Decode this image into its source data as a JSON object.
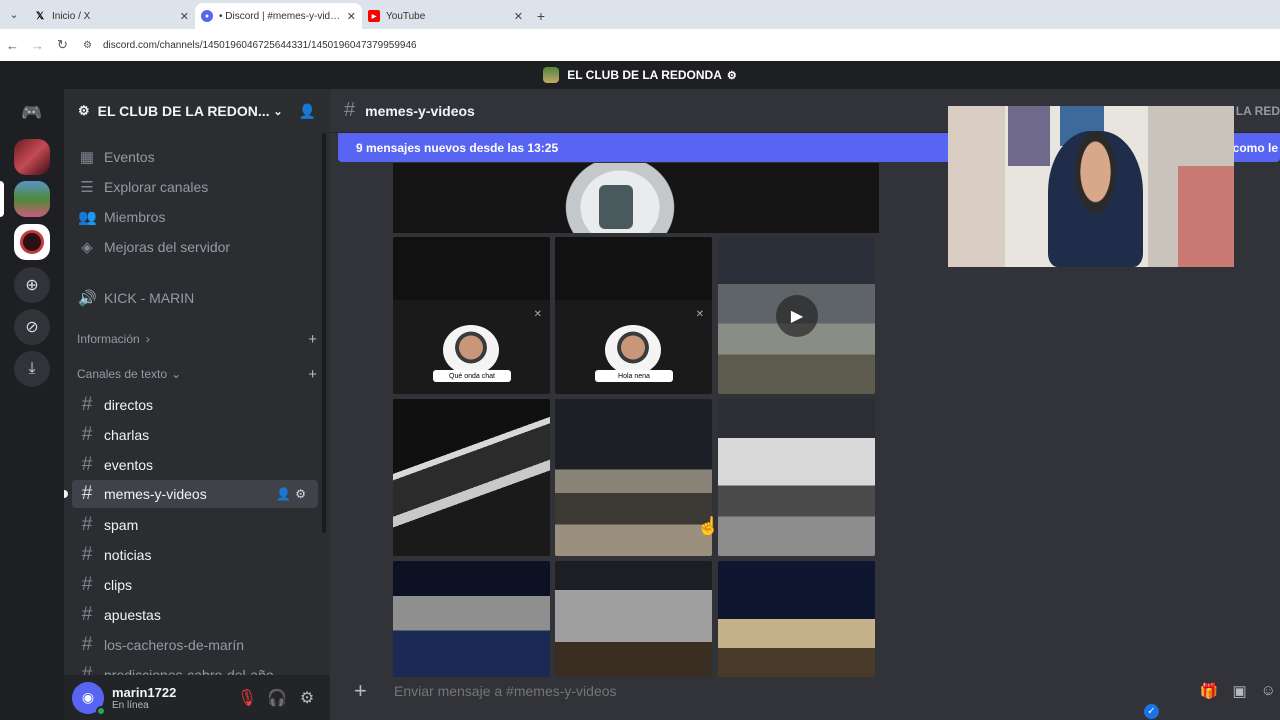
{
  "browser": {
    "tabs": [
      {
        "title": "Inicio / X",
        "icon": "x-logo-icon"
      },
      {
        "title": "• Discord | #memes-y-videos | EL",
        "icon": "discord-favicon-icon"
      },
      {
        "title": "YouTube",
        "icon": "youtube-icon"
      }
    ],
    "url": "discord.com/channels/1450196046725644331/1450196047379959946"
  },
  "titlebar": {
    "server": "EL CLUB DE LA REDONDA"
  },
  "server": {
    "name": "EL CLUB DE LA REDON...",
    "menu": [
      {
        "label": "Eventos",
        "icon": "calendar-icon"
      },
      {
        "label": "Explorar canales",
        "icon": "browse-channels-icon"
      },
      {
        "label": "Miembros",
        "icon": "members-icon"
      },
      {
        "label": "Mejoras del servidor",
        "icon": "boost-icon"
      }
    ],
    "voice_channel": "KICK - MARIN",
    "categories": {
      "info": "Información",
      "text": "Canales de texto"
    },
    "text_channels": [
      "directos",
      "charlas",
      "eventos",
      "memes-y-videos",
      "spam",
      "noticias",
      "clips",
      "apuestas",
      "los-cacheros-de-marín",
      "predicciones-cabro-del-año"
    ]
  },
  "user": {
    "name": "marin1722",
    "status": "En línea"
  },
  "chat": {
    "channel": "memes-y-videos",
    "header_right": "E LA RED",
    "new_messages": "9 mensajes nuevos desde las 13:25",
    "new_messages_right": "como le",
    "sticker_captions": [
      "Qué onda chat",
      "Hola nena"
    ],
    "composer_placeholder": "Enviar mensaje a #memes-y-videos"
  },
  "colors": {
    "blurple": "#5865f2",
    "online": "#23a55a",
    "danger": "#f23f43"
  }
}
